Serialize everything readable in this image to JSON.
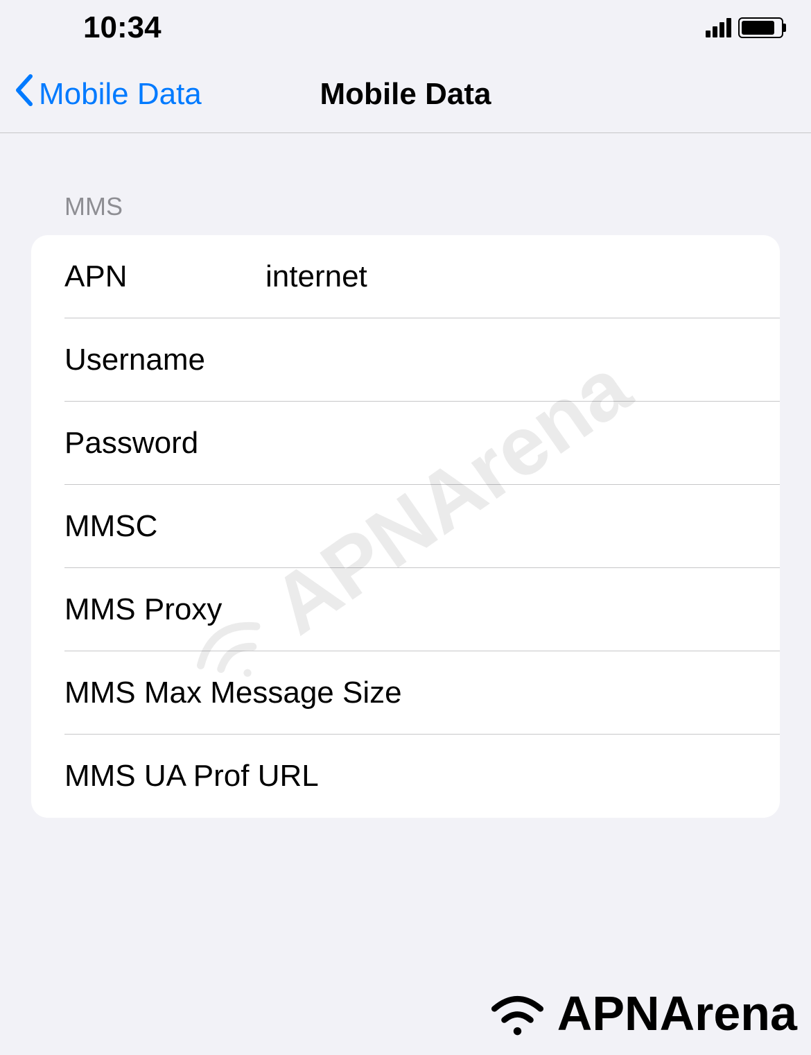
{
  "status": {
    "time": "10:34"
  },
  "nav": {
    "back_label": "Mobile Data",
    "title": "Mobile Data"
  },
  "section": {
    "header": "MMS"
  },
  "fields": {
    "apn": {
      "label": "APN",
      "value": "internet"
    },
    "username": {
      "label": "Username",
      "value": ""
    },
    "password": {
      "label": "Password",
      "value": ""
    },
    "mmsc": {
      "label": "MMSC",
      "value": ""
    },
    "mms_proxy": {
      "label": "MMS Proxy",
      "value": ""
    },
    "mms_max_size": {
      "label": "MMS Max Message Size",
      "value": ""
    },
    "mms_ua_prof": {
      "label": "MMS UA Prof URL",
      "value": ""
    }
  },
  "watermark": {
    "text": "APNArena"
  },
  "footer": {
    "brand": "APNArena"
  }
}
